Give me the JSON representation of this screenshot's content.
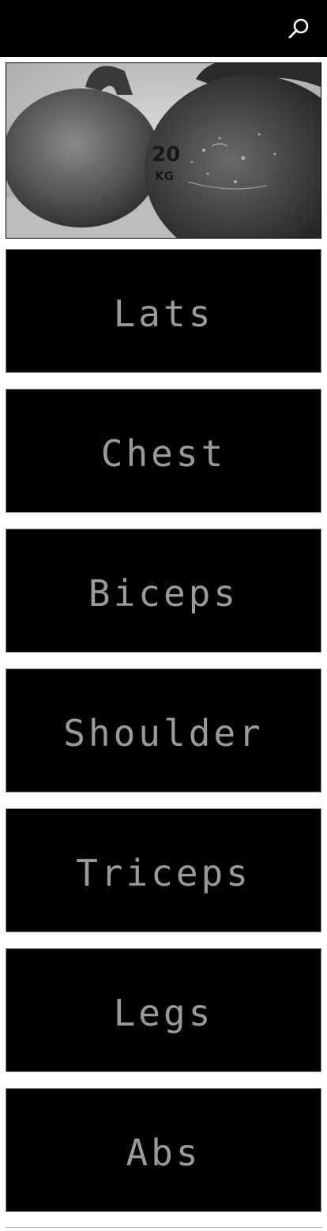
{
  "header": {
    "search_icon": "search-icon"
  },
  "hero": {
    "image": "kettlebell-photo",
    "weight_text": "20",
    "unit_text": "KG"
  },
  "categories": [
    {
      "label": "Lats"
    },
    {
      "label": "Chest"
    },
    {
      "label": "Biceps"
    },
    {
      "label": "Shoulder"
    },
    {
      "label": "Triceps"
    },
    {
      "label": "Legs"
    },
    {
      "label": "Abs"
    }
  ],
  "colors": {
    "background": "#ffffff",
    "tile": "#000000",
    "tile_text": "#9a9a9a",
    "header": "#000000"
  }
}
